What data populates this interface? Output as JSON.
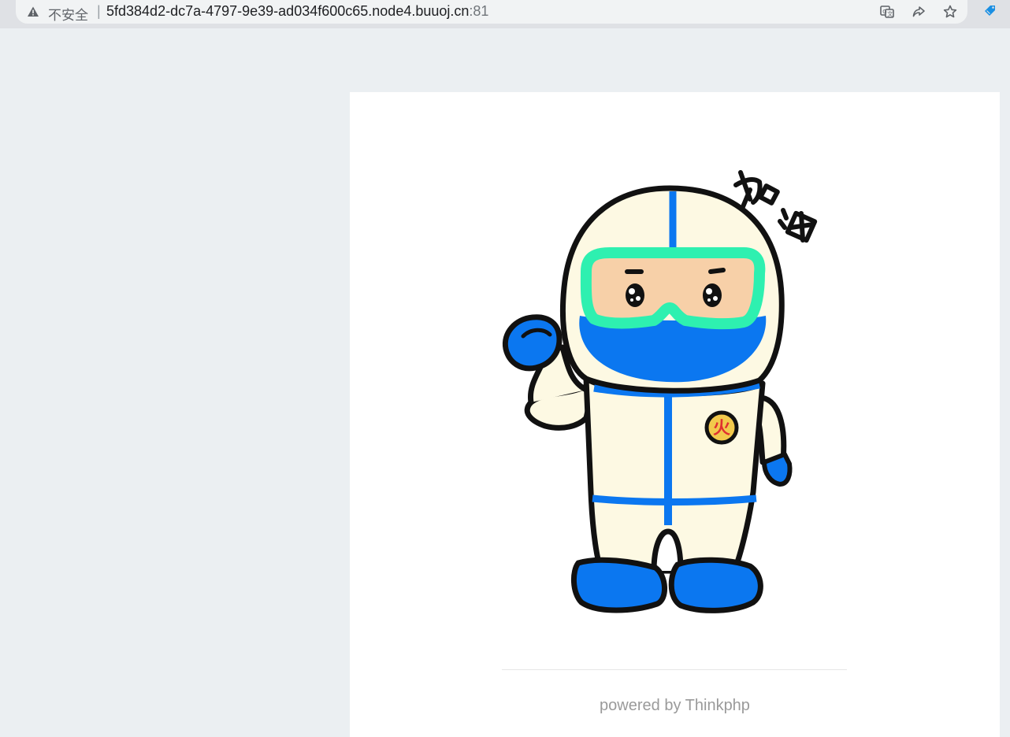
{
  "browser": {
    "security_label": "不安全",
    "separator": "|",
    "url_host": "5fd384d2-dc7a-4797-9e39-ad034f600c65.node4.buuoj.cn",
    "url_port": ":81",
    "icons": [
      "warning-icon",
      "translate-icon",
      "share-icon",
      "bookmark-star-icon",
      "extension-icon"
    ]
  },
  "page": {
    "illustration": {
      "description_label": "加油",
      "badge_glyph": "火",
      "colors": {
        "suit": "#fdf9e3",
        "blue": "#0b77f0",
        "visor": "#2ef0b0",
        "face": "#f7d0a8",
        "badge": "#f2c94c",
        "badge_text": "#e03030"
      }
    },
    "footer": {
      "powered_by": "powered by",
      "framework": "Thinkphp"
    }
  }
}
